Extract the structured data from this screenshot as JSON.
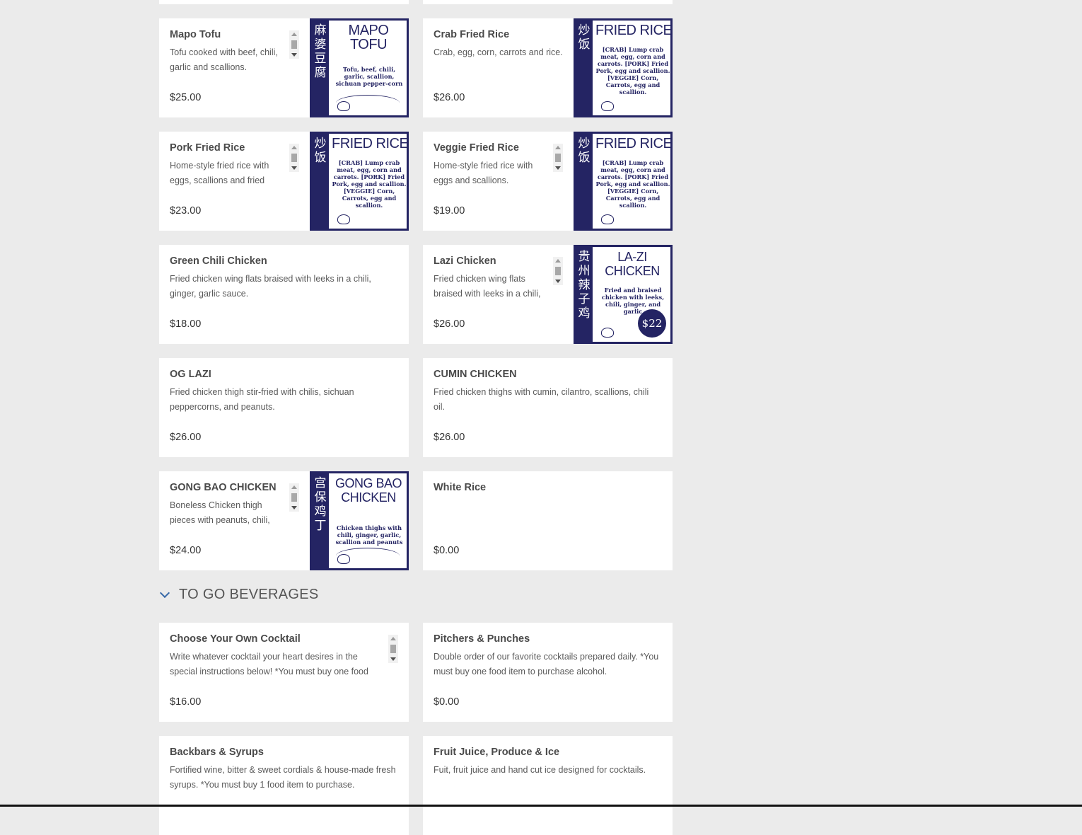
{
  "dishes": [
    {
      "name": "Mapo Tofu",
      "desc": "Tofu cooked with beef, chili, garlic and scallions.",
      "price": "$25.00",
      "img": {
        "band": "麻婆豆腐",
        "title": "MAPO TOFU",
        "sub": "Tofu, beef, chili, garlic, scallion, sichuan pepper-corn"
      }
    },
    {
      "name": "Crab Fried Rice",
      "desc": "Crab, egg, corn, carrots and rice.",
      "price": "$26.00",
      "img": {
        "band": "炒饭",
        "title": "FRIED RICE",
        "sub": "[CRAB] Lump crab meat, egg, corn and carrots. [PORK] Fried Pork, egg and scallion. [VEGGIE] Corn, Carrots, egg and scallion."
      }
    },
    {
      "name": "Pork Fried Rice",
      "desc": "Home-style fried rice with eggs, scallions and fried",
      "price": "$23.00",
      "img": {
        "band": "炒饭",
        "title": "FRIED RICE",
        "sub": "[CRAB] Lump crab meat, egg, corn and carrots. [PORK] Fried Pork, egg and scallion. [VEGGIE] Corn, Carrots, egg and scallion."
      }
    },
    {
      "name": "Veggie Fried Rice",
      "desc": "Home-style fried rice with eggs and scallions.",
      "price": "$19.00",
      "img": {
        "band": "炒饭",
        "title": "FRIED RICE",
        "sub": "[CRAB] Lump crab meat, egg, corn and carrots. [PORK] Fried Pork, egg and scallion. [VEGGIE] Corn, Carrots, egg and scallion."
      }
    },
    {
      "name": "Green Chili Chicken",
      "desc": "Fried chicken wing flats braised with leeks in a chili, ginger, garlic sauce.",
      "price": "$18.00"
    },
    {
      "name": "Lazi Chicken",
      "desc": "Fried chicken wing flats braised with leeks in a chili,",
      "price": "$26.00",
      "img": {
        "band": "贵州辣子鸡",
        "title": "LA-ZI CHICKEN",
        "sub": "Fried and braised chicken with leeks, chili, ginger, and garlic",
        "badge": "$22"
      }
    },
    {
      "name": "OG LAZI",
      "desc": "Fried chicken thigh stir-fried with chilis, sichuan peppercorns, and peanuts.",
      "price": "$26.00"
    },
    {
      "name": "CUMIN CHICKEN",
      "desc": "Fried chicken thighs with cumin, cilantro, scallions, chili oil.",
      "price": "$26.00"
    },
    {
      "name": "GONG BAO CHICKEN",
      "desc": "Boneless Chicken thigh pieces with peanuts, chili,",
      "price": "$24.00",
      "img": {
        "band": "宫保鸡丁",
        "title": "GONG BAO CHICKEN",
        "sub": "Chicken thighs with chili, ginger, garlic, scallion and peanuts"
      }
    },
    {
      "name": "White Rice",
      "desc": "",
      "price": "$0.00"
    }
  ],
  "section": {
    "title": "TO GO BEVERAGES"
  },
  "beverages": [
    {
      "name": "Choose Your Own Cocktail",
      "desc": "Write whatever cocktail your heart desires in the special instructions below! *You must buy one food",
      "price": "$16.00"
    },
    {
      "name": "Pitchers & Punches",
      "desc": "Double order of our favorite cocktails prepared daily. *You must buy one food item to purchase alcohol.",
      "price": "$0.00"
    },
    {
      "name": "Backbars & Syrups",
      "desc": "Fortified wine, bitter & sweet cordials & house-made fresh syrups. *You must buy 1 food item to purchase.",
      "price": ""
    },
    {
      "name": "Fruit Juice, Produce & Ice",
      "desc": "Fuit, fruit juice and hand cut ice designed for cocktails.",
      "price": ""
    }
  ]
}
